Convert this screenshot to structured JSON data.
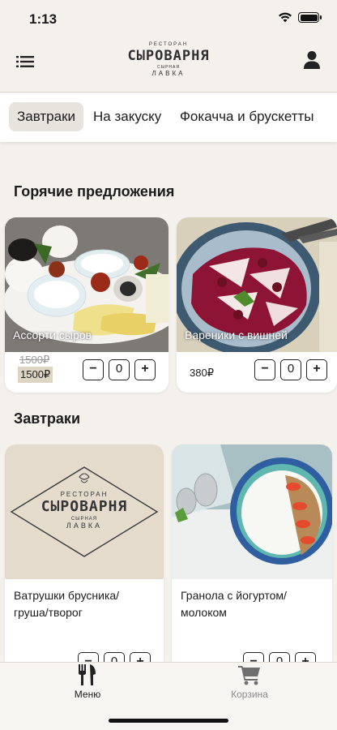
{
  "status_bar": {
    "time": "1:13",
    "icons": [
      "wifi-icon",
      "battery-icon"
    ]
  },
  "header": {
    "menu_icon": "list-icon",
    "profile_icon": "user-icon",
    "logo": {
      "top": "РЕСТОРАН",
      "main": "СЫРОВАРНЯ",
      "sub1": "СЫРНАЯ",
      "sub2": "ЛАВКА"
    }
  },
  "tabs": [
    {
      "label": "Завтраки",
      "active": true
    },
    {
      "label": "На закуску",
      "active": false
    },
    {
      "label": "Фокачча и брускетты",
      "active": false
    }
  ],
  "sections": [
    {
      "title": "Горячие предложения",
      "items": [
        {
          "name": "Ассорти сыров",
          "old_price": "1500₽",
          "price": "1500₽",
          "qty": "0"
        },
        {
          "name": "Вареники с вишней",
          "price": "380₽",
          "qty": "0"
        }
      ]
    },
    {
      "title": "Завтраки",
      "items": [
        {
          "name": "Ватрушки брусника/ груша/творог",
          "qty": "0"
        },
        {
          "name": "Гранола с йогуртом/ молоком",
          "qty": "0"
        }
      ]
    }
  ],
  "stepper": {
    "minus": "−",
    "plus": "+"
  },
  "placeholder_logo": {
    "top": "РЕСТОРАН",
    "main": "СЫРОВАРНЯ",
    "sub1": "СЫРНАЯ",
    "sub2": "ЛАВКА"
  },
  "bottom_tabs": [
    {
      "label": "Меню",
      "icon": "fork-knife-icon",
      "active": true
    },
    {
      "label": "Корзина",
      "icon": "cart-icon",
      "active": false
    }
  ],
  "colors": {
    "background": "#f4f1ec",
    "active_tab": "#e7e3dd",
    "price_highlight": "#ddd4c4",
    "inactive_tab": "#8a8a8a"
  }
}
